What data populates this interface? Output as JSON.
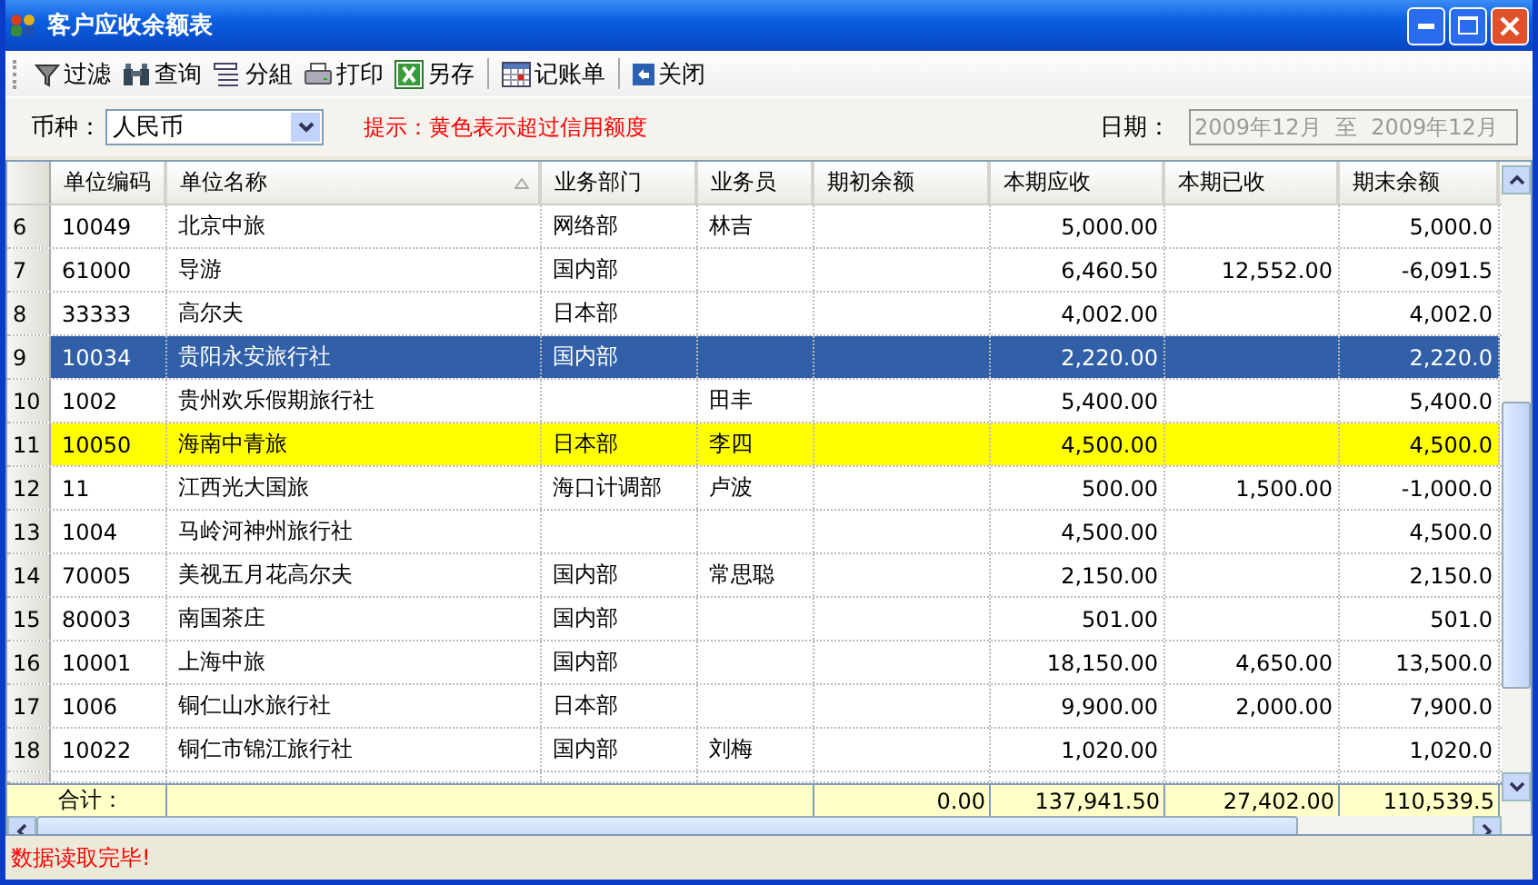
{
  "window": {
    "title": "客户应收余额表"
  },
  "toolbar": {
    "groups": [
      [
        "过滤",
        "查询",
        "分組",
        "打印",
        "另存"
      ],
      [
        "记账单"
      ],
      [
        "关闭"
      ]
    ]
  },
  "filter": {
    "currency_label": "币种：",
    "currency": "人民币",
    "hint": "提示：黄色表示超过信用额度",
    "date_label": "日期：",
    "date_value": "2009年12月  至  2009年12月",
    "date_disabled": true
  },
  "table": {
    "columns": [
      {
        "label": "单位编码",
        "sorted": false,
        "kind": "text"
      },
      {
        "label": "单位名称",
        "sorted": true,
        "kind": "text"
      },
      {
        "label": "业务部门",
        "sorted": false,
        "kind": "text"
      },
      {
        "label": "业务员",
        "sorted": false,
        "kind": "text"
      },
      {
        "label": "期初余额",
        "sorted": false,
        "kind": "amount"
      },
      {
        "label": "本期应收",
        "sorted": false,
        "kind": "amount"
      },
      {
        "label": "本期已收",
        "sorted": false,
        "kind": "amount"
      },
      {
        "label": "期末余额",
        "sorted": false,
        "kind": "amount"
      }
    ],
    "rows": [
      {
        "number": "6",
        "cells": [
          "10049",
          "北京中旅",
          "网络部",
          "林吉",
          "",
          "5,000.00",
          "",
          "5,000.0"
        ],
        "selected": false,
        "over_credit": false
      },
      {
        "number": "7",
        "cells": [
          "61000",
          "导游",
          "国内部",
          "",
          "",
          "6,460.50",
          "12,552.00",
          "-6,091.5"
        ],
        "selected": false,
        "over_credit": false
      },
      {
        "number": "8",
        "cells": [
          "33333",
          "高尔夫",
          "日本部",
          "",
          "",
          "4,002.00",
          "",
          "4,002.0"
        ],
        "selected": false,
        "over_credit": false
      },
      {
        "number": "9",
        "cells": [
          "10034",
          "贵阳永安旅行社",
          "国内部",
          "",
          "",
          "2,220.00",
          "",
          "2,220.0"
        ],
        "selected": true,
        "over_credit": false
      },
      {
        "number": "10",
        "cells": [
          "1002",
          "贵州欢乐假期旅行社",
          "",
          "田丰",
          "",
          "5,400.00",
          "",
          "5,400.0"
        ],
        "selected": false,
        "over_credit": false
      },
      {
        "number": "11",
        "cells": [
          "10050",
          "海南中青旅",
          "日本部",
          "李四",
          "",
          "4,500.00",
          "",
          "4,500.0"
        ],
        "selected": false,
        "over_credit": true
      },
      {
        "number": "12",
        "cells": [
          "11",
          "江西光大国旅",
          "海口计调部",
          "卢波",
          "",
          "500.00",
          "1,500.00",
          "-1,000.0"
        ],
        "selected": false,
        "over_credit": false
      },
      {
        "number": "13",
        "cells": [
          "1004",
          "马岭河神州旅行社",
          "",
          "",
          "",
          "4,500.00",
          "",
          "4,500.0"
        ],
        "selected": false,
        "over_credit": false
      },
      {
        "number": "14",
        "cells": [
          "70005",
          "美视五月花高尔夫",
          "国内部",
          "常思聪",
          "",
          "2,150.00",
          "",
          "2,150.0"
        ],
        "selected": false,
        "over_credit": false
      },
      {
        "number": "15",
        "cells": [
          "80003",
          "南国茶庄",
          "国内部",
          "",
          "",
          "501.00",
          "",
          "501.0"
        ],
        "selected": false,
        "over_credit": false
      },
      {
        "number": "16",
        "cells": [
          "10001",
          "上海中旅",
          "国内部",
          "",
          "",
          "18,150.00",
          "4,650.00",
          "13,500.0"
        ],
        "selected": false,
        "over_credit": false
      },
      {
        "number": "17",
        "cells": [
          "1006",
          "铜仁山水旅行社",
          "日本部",
          "",
          "",
          "9,900.00",
          "2,000.00",
          "7,900.0"
        ],
        "selected": false,
        "over_credit": false
      },
      {
        "number": "18",
        "cells": [
          "10022",
          "铜仁市锦江旅行社",
          "国内部",
          "刘梅",
          "",
          "1,020.00",
          "",
          "1,020.0"
        ],
        "selected": false,
        "over_credit": false
      }
    ],
    "totals": {
      "label": "合计：",
      "values": [
        "0.00",
        "137,941.50",
        "27,402.00",
        "110,539.5"
      ]
    }
  },
  "status_bar": {
    "message": "数据读取完毕!"
  }
}
